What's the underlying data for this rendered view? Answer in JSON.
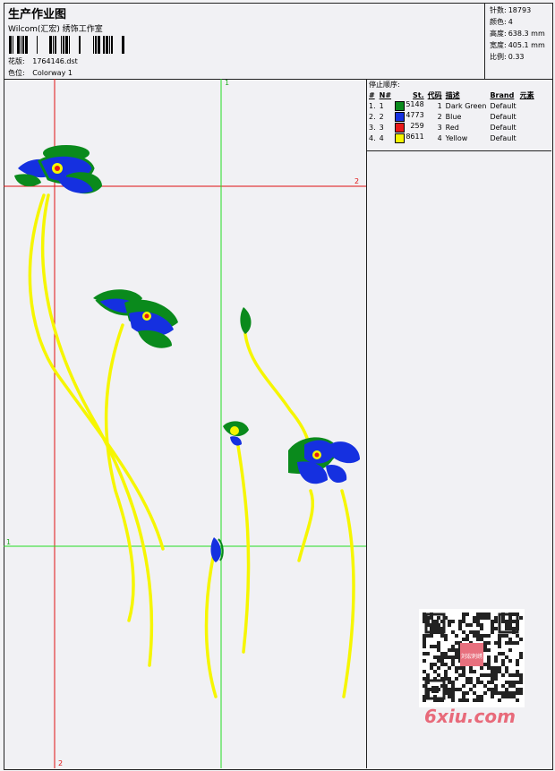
{
  "header": {
    "title": "生产作业图",
    "subtitle": "Wilcom(汇宏) 绣饰工作室",
    "design_label": "花版:",
    "design_value": "1764146.dst",
    "colorway_label": "色位:",
    "colorway_value": "Colorway 1"
  },
  "stats": {
    "stitches_label": "针数:",
    "stitches_value": "18793",
    "colors_label": "颜色:",
    "colors_value": "4",
    "height_label": "高度:",
    "height_value": "638.3 mm",
    "width_label": "宽度:",
    "width_value": "405.1 mm",
    "scale_label": "比例:",
    "scale_value": "0.33"
  },
  "legend": {
    "title": "停止顺序:",
    "headers": [
      "#",
      "N#",
      "St.",
      "代码",
      "描述",
      "Brand",
      "元素"
    ],
    "rows": [
      {
        "idx": "1.",
        "n": "1",
        "color": "#0a8a1c",
        "st": "5148",
        "code": "1",
        "desc": "Dark Green",
        "brand": "Default"
      },
      {
        "idx": "2.",
        "n": "2",
        "color": "#1530e0",
        "st": "4773",
        "code": "2",
        "desc": "Blue",
        "brand": "Default"
      },
      {
        "idx": "3.",
        "n": "3",
        "color": "#e81818",
        "st": "259",
        "code": "3",
        "desc": "Red",
        "brand": "Default"
      },
      {
        "idx": "4.",
        "n": "4",
        "color": "#f6f600",
        "st": "8611",
        "code": "4",
        "desc": "Yellow",
        "brand": "Default"
      }
    ]
  },
  "guides": {
    "v1_label": "1",
    "h2_label": "2",
    "h1_label": "1",
    "v2_label": "2",
    "red_color": "#e01010",
    "green_color": "#22dd22"
  },
  "watermark": {
    "text": "6xiu.com",
    "stamp": "刘宏刺绣"
  },
  "colors": {
    "dark_green": "#0a8a1c",
    "blue": "#1530e0",
    "red": "#e81818",
    "yellow": "#f6f600"
  }
}
